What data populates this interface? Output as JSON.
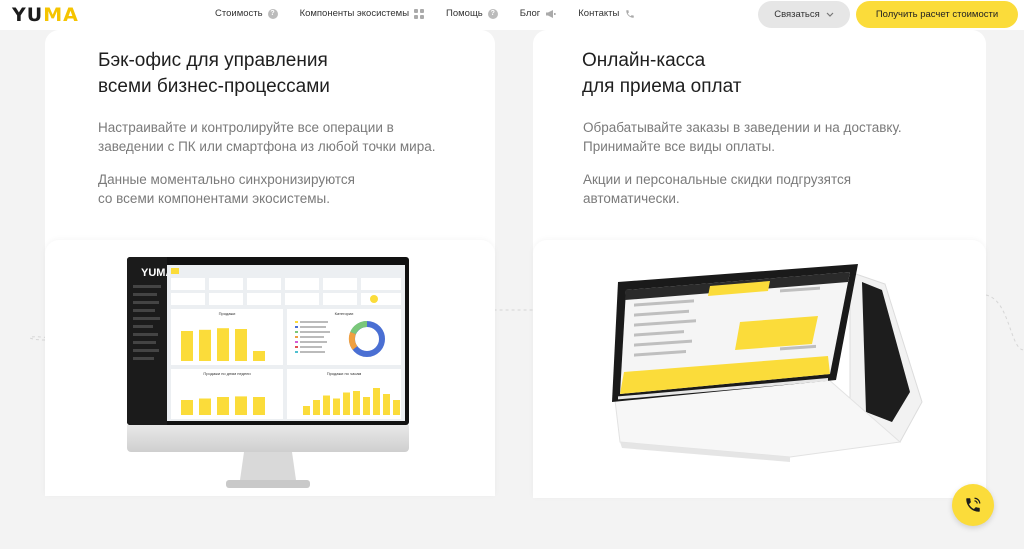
{
  "header": {
    "logo_prefix": "YU",
    "logo_accent": "MA",
    "nav": [
      {
        "label": "Стоимость",
        "icon": "question-icon"
      },
      {
        "label": "Компоненты экосистемы",
        "icon": "grid-icon"
      },
      {
        "label": "Помощь",
        "icon": "question-icon"
      },
      {
        "label": "Блог",
        "icon": "megaphone-icon"
      },
      {
        "label": "Контакты",
        "icon": "phone-icon"
      }
    ],
    "contact_label": "Связаться",
    "cta_label": "Получить расчет стоимости"
  },
  "cards": {
    "left": {
      "title_line1": "Бэк-офис для управления",
      "title_line2": "всеми бизнес-процессами",
      "p1_line1": "Настраивайте и контролируйте все операции в",
      "p1_line2": "заведении с ПК или смартфона из любой точки мира.",
      "p2_line1": "Данные моментально синхронизируются",
      "p2_line2": "со всеми компонентами экосистемы."
    },
    "right": {
      "title_line1": "Онлайн-касса",
      "title_line2": "для приема оплат",
      "p1_line1": "Обрабатывайте заказы в заведении и на доставку.",
      "p1_line2": "Принимайте все виды оплаты.",
      "p2_line1": "Акции и персональные скидки подгрузятся",
      "p2_line2": "автоматически."
    }
  },
  "monitor": {
    "logo": "YUMA",
    "sales_label": "Продажи",
    "categories_label": "Категории",
    "sales_by_weekday_label": "Продажи по дням недели",
    "sales_by_hour_label": "Продажи по часам",
    "bars_sales": [
      0.75,
      0.78,
      0.82,
      0.8,
      0.25
    ],
    "bars_weekday": [
      0.5,
      0.55,
      0.6,
      0.62,
      0.6
    ],
    "bars_hour": [
      0.3,
      0.5,
      0.65,
      0.55,
      0.75,
      0.8,
      0.6,
      0.9,
      0.7,
      0.5
    ]
  },
  "colors": {
    "accent": "#fbdc3a",
    "dark": "#1c1c1c",
    "muted_text": "#7a7a7a"
  }
}
